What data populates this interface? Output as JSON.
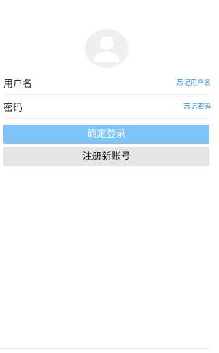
{
  "login": {
    "avatar_icon": "user-avatar-icon",
    "username_label": "用户名",
    "username_value": "",
    "forgot_username": "忘记用户名",
    "password_label": "密码",
    "password_value": "",
    "forgot_password": "忘记密码",
    "login_button": "确定登录",
    "register_button": "注册新账号"
  },
  "colors": {
    "accent": "#7fc4f7",
    "link": "#2b8fd6",
    "secondary_button": "#e5e5e5"
  }
}
